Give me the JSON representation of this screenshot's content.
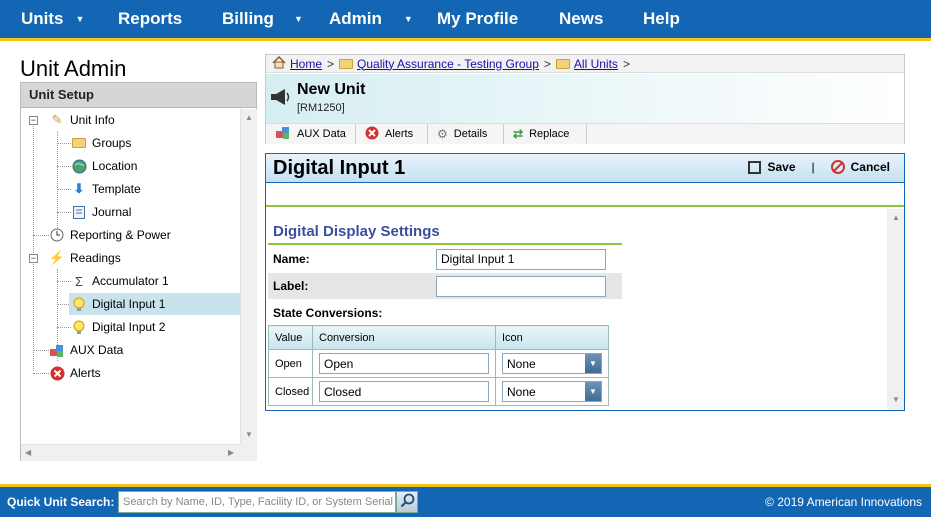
{
  "nav": {
    "items": [
      {
        "label": "Units",
        "dropdown": true
      },
      {
        "label": "Reports",
        "dropdown": false
      },
      {
        "label": "Billing",
        "dropdown": true
      },
      {
        "label": "Admin",
        "dropdown": true
      },
      {
        "label": "My Profile",
        "dropdown": false
      },
      {
        "label": "News",
        "dropdown": false
      },
      {
        "label": "Help",
        "dropdown": false
      }
    ],
    "arrow": "▼"
  },
  "page_title": "Unit Admin",
  "unit_setup": {
    "header": "Unit Setup",
    "tree": [
      {
        "label": "Unit Info",
        "icon": "pencil-icon"
      },
      {
        "label": "Groups",
        "icon": "folder-icon"
      },
      {
        "label": "Location",
        "icon": "globe-icon"
      },
      {
        "label": "Template",
        "icon": "download-icon"
      },
      {
        "label": "Journal",
        "icon": "journal-icon"
      },
      {
        "label": "Reporting & Power",
        "icon": "clock-icon"
      },
      {
        "label": "Readings",
        "icon": "lightning-icon"
      },
      {
        "label": "Accumulator 1",
        "icon": "sigma-icon"
      },
      {
        "label": "Digital Input 1",
        "icon": "lightbulb-icon"
      },
      {
        "label": "Digital Input 2",
        "icon": "lightbulb-icon"
      },
      {
        "label": "AUX Data",
        "icon": "cubes-icon"
      },
      {
        "label": "Alerts",
        "icon": "alert-icon"
      }
    ]
  },
  "breadcrumb": {
    "items": [
      "Home",
      "Quality Assurance - Testing Group",
      "All Units"
    ],
    "separator": ">"
  },
  "unit": {
    "title": "New Unit",
    "subtitle": "[RM1250]"
  },
  "tabs": [
    {
      "label": "AUX Data",
      "icon": "cubes-icon"
    },
    {
      "label": "Alerts",
      "icon": "alert-icon"
    },
    {
      "label": "Details",
      "icon": "gear-icon"
    },
    {
      "label": "Replace",
      "icon": "replace-icon"
    }
  ],
  "panel": {
    "title": "Digital Input 1",
    "save_label": "Save",
    "separator": "|",
    "cancel_label": "Cancel"
  },
  "settings": {
    "section_title": "Digital Display Settings",
    "name_label": "Name:",
    "name_value": "Digital Input 1",
    "label_label": "Label:",
    "label_value": "",
    "state_conversions_label": "State Conversions:",
    "table": {
      "headers": [
        "Value",
        "Conversion",
        "Icon"
      ],
      "rows": [
        {
          "value": "Open",
          "conversion": "Open",
          "icon": "None"
        },
        {
          "value": "Closed",
          "conversion": "Closed",
          "icon": "None"
        }
      ]
    }
  },
  "footer": {
    "quick_search_label": "Quick Unit Search:",
    "quick_search_placeholder": "Search by Name, ID, Type, Facility ID, or System Serial",
    "copyright": "© 2019 American Innovations"
  }
}
